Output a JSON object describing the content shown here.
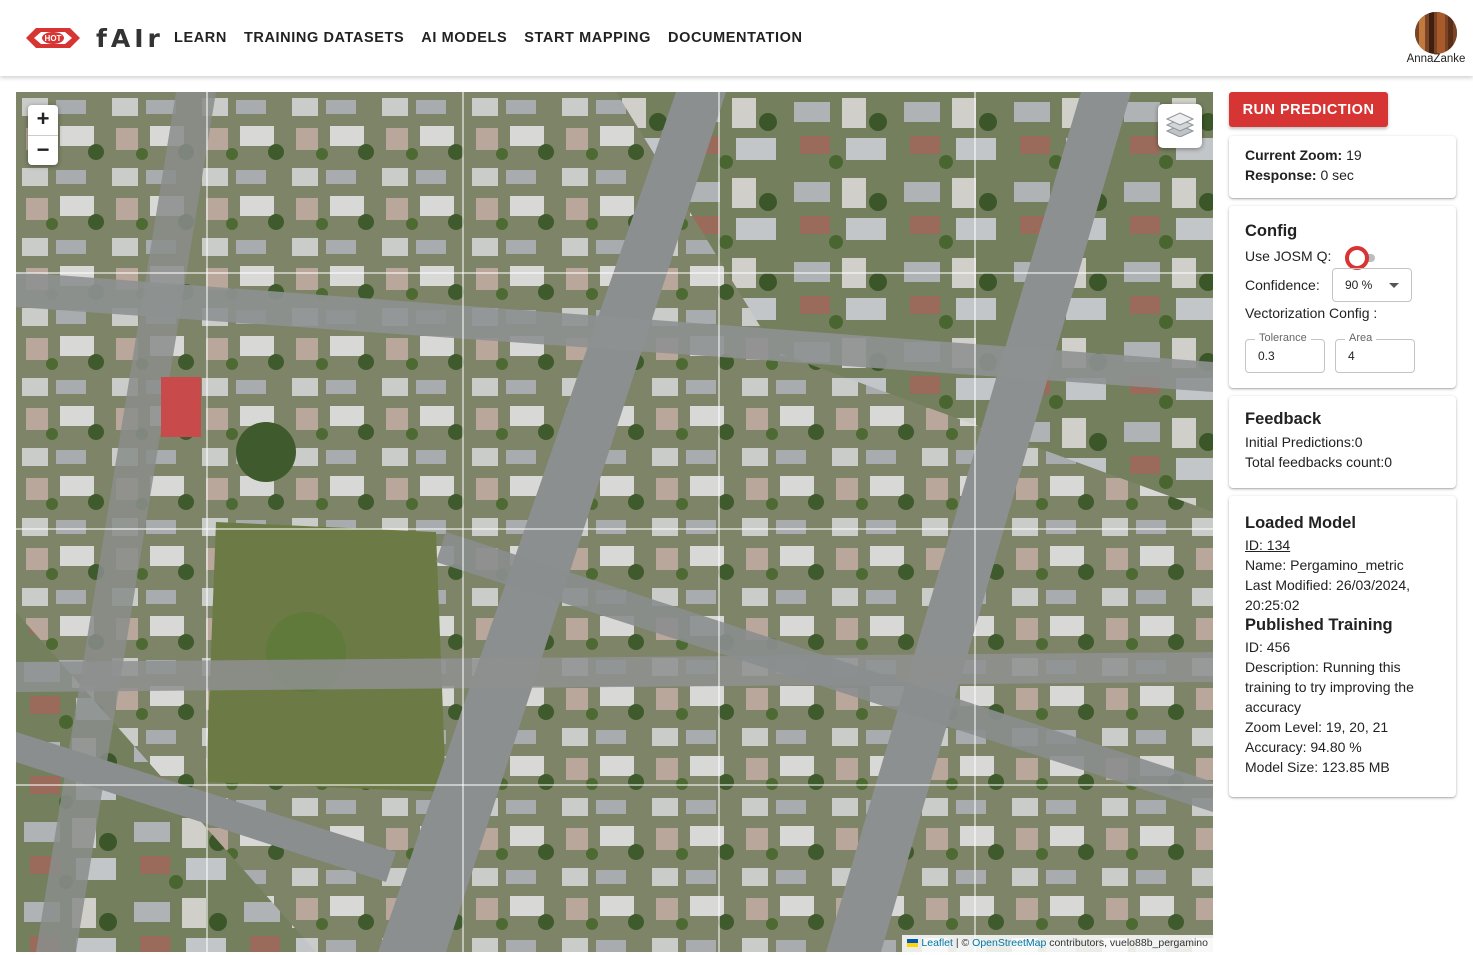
{
  "header": {
    "brand": "fAIr",
    "logo_text": "HOT",
    "nav": [
      "LEARN",
      "TRAINING DATASETS",
      "AI MODELS",
      "START MAPPING",
      "DOCUMENTATION"
    ],
    "username": "AnnaZanke"
  },
  "map": {
    "zoom_in": "+",
    "zoom_out": "−",
    "attribution": {
      "leaflet": "Leaflet",
      "separator": "| ©",
      "osm": "OpenStreetMap",
      "rest": "contributors, vuelo88b_pergamino"
    }
  },
  "actions": {
    "run_prediction": "RUN PREDICTION"
  },
  "status": {
    "zoom_label": "Current Zoom:",
    "zoom_value": "19",
    "response_label": "Response:",
    "response_value": "0 sec"
  },
  "config": {
    "title": "Config",
    "josm_label": "Use JOSM Q:",
    "josm_enabled": false,
    "confidence_label": "Confidence:",
    "confidence_value": "90 %",
    "vectorization_label": "Vectorization Config :",
    "tolerance_label": "Tolerance",
    "tolerance_value": "0.3",
    "area_label": "Area",
    "area_value": "4"
  },
  "feedback": {
    "title": "Feedback",
    "initial_predictions": "Initial Predictions:0",
    "total_feedbacks": "Total feedbacks count:0"
  },
  "model": {
    "title": "Loaded Model",
    "id": "ID: 134",
    "name": "Name: Pergamino_metric",
    "last_modified_1": "Last Modified: 26/03/2024,",
    "last_modified_2": "20:25:02",
    "training_title": "Published Training",
    "training_id": "ID: 456",
    "desc_1": "Description: Running this",
    "desc_2": "training to try improving the",
    "desc_3": "accuracy",
    "zoom_levels": "Zoom Level: 19, 20, 21",
    "accuracy": "Accuracy: 94.80 %",
    "size": "Model Size: 123.85 MB"
  },
  "colors": {
    "accent": "#d73434",
    "link": "#0078a8",
    "imagery_base": "#6f7a5e",
    "road": "#8c8f8f"
  }
}
